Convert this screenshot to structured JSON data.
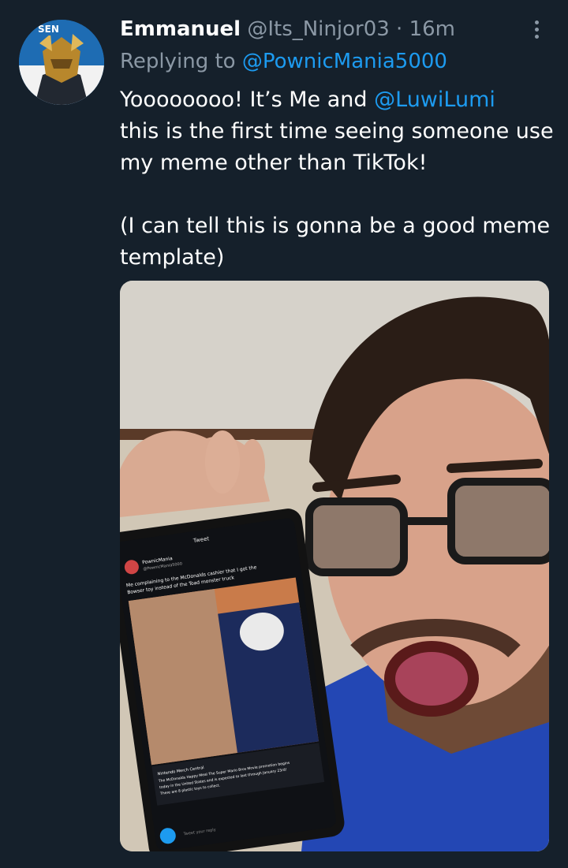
{
  "tweet": {
    "author_name": "Emmanuel",
    "author_handle": "@Its_Ninjor03",
    "separator": " · ",
    "time": "16m",
    "replying_prefix": "Replying to ",
    "replying_to": "@PownicMania5000",
    "line1_text": "Yoooooooo! It’s Me and ",
    "line1_mention": "@LuwiLumi",
    "line2": "this is the first time seeing someone use my meme other than TikTok!",
    "line3": "(I can tell this is gonna be a good meme template)",
    "avatar_badge": "SEN"
  },
  "media": {
    "tablet": {
      "header": "Tweet",
      "account_name": "PownicMania",
      "account_handle": "@PownicMania5000",
      "caption_1": "Me complaining to the McDonalds cashier that I got the",
      "caption_2": "Bowser toy instead of the Toad monster truck",
      "quote_source": "Nintendo Merch Central",
      "quote_1": "The McDonalds Happy Meal The Super Mario Bros Movie promotion begins",
      "quote_2": "today in the United States and is expected to last through January 23rd!",
      "quote_3": "There are 8 plastic toys to collect.",
      "reply_placeholder": "Tweet your reply"
    }
  },
  "colors": {
    "background": "#15202b",
    "text": "#ffffff",
    "muted": "#8b98a5",
    "link": "#1d9bf0"
  }
}
